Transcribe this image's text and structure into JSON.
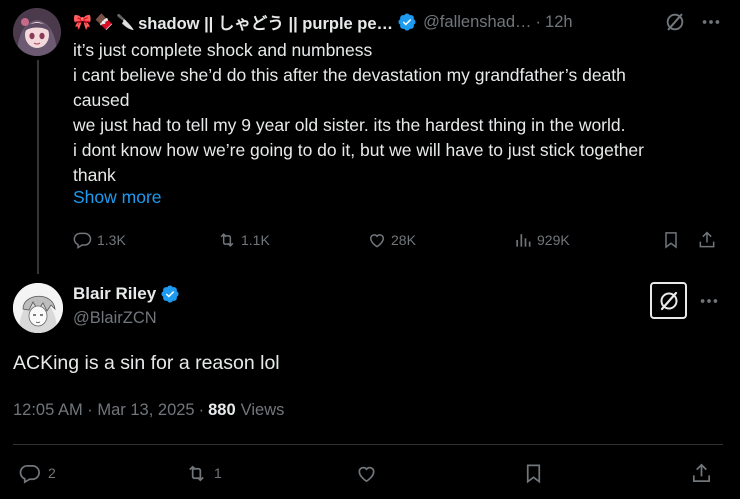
{
  "parent_tweet": {
    "display_name": "shadow || しゃどう || purple pe…",
    "emojis": [
      "🎀",
      "🍫",
      "🔪"
    ],
    "handle": "@fallenshad…",
    "time": "12h",
    "body_lines": [
      "it’s just complete shock and numbness",
      "i cant believe she’d do this after the devastation my grandfather’s death",
      "caused",
      "we just had to tell my 9 year old sister. its the hardest thing in the world.",
      "i dont know how we’re going to do it, but we will have to just stick together",
      "thank"
    ],
    "show_more": "Show more",
    "actions": {
      "replies": "1.3K",
      "reposts": "1.1K",
      "likes": "28K",
      "views": "929K"
    }
  },
  "main_tweet": {
    "display_name": "Blair Riley",
    "handle": "@BlairZCN",
    "text": "ACKing is a sin for a reason lol",
    "timestamp": "12:05 AM · Mar 13, 2025",
    "separator": "·",
    "views_count": "880",
    "views_label": "Views",
    "actions": {
      "replies": "2",
      "reposts": "1"
    }
  },
  "colors": {
    "background": "#000000",
    "text": "#e7e9ea",
    "muted": "#71767b",
    "accent": "#1d9bf0",
    "divider": "#2f3336"
  },
  "icons": [
    "reply-icon",
    "repost-icon",
    "like-icon",
    "views-icon",
    "bookmark-icon",
    "share-icon",
    "grok-icon",
    "more-icon",
    "verified-badge-icon"
  ]
}
